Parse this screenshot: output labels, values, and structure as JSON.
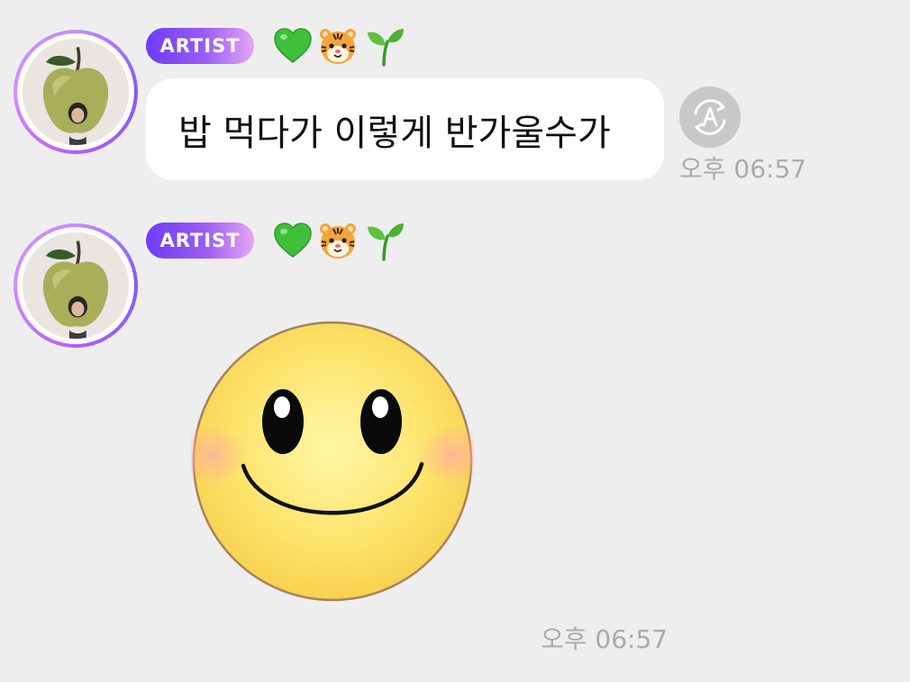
{
  "messages": [
    {
      "badge": "ARTIST",
      "emojis": [
        "green-heart",
        "tiger-face",
        "seedling"
      ],
      "text": "밥 먹다가 이렇게 반가울수가",
      "time": "오후 06:57"
    },
    {
      "badge": "ARTIST",
      "emojis": [
        "green-heart",
        "tiger-face",
        "seedling"
      ],
      "sticker": "smiley-face-sticker",
      "time": "오후 06:57"
    }
  ],
  "colors": {
    "background": "#efeeef",
    "badge_start": "#6d3cf6",
    "badge_end": "#e6a6f5",
    "bubble": "#ffffff",
    "timestamp": "#aaaaaa",
    "translate_button": "#c9c8c9"
  },
  "icons": {
    "translate_button": "translate-icon"
  }
}
